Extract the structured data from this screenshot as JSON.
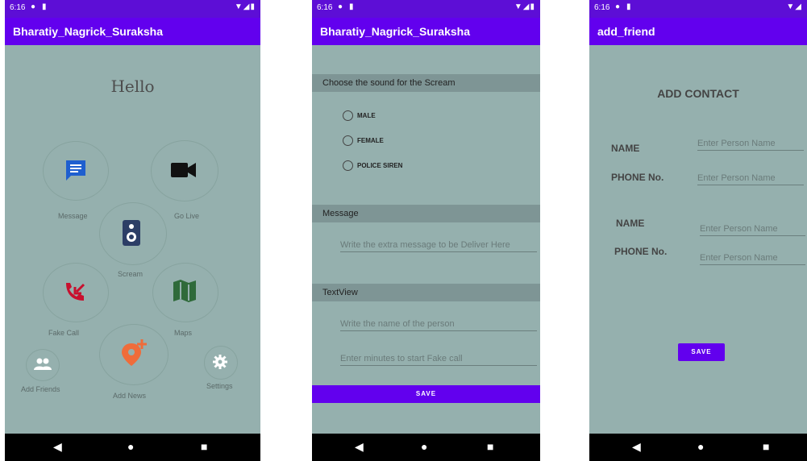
{
  "status_time": "6:16",
  "phone1": {
    "app_title": "Bharatiy_Nagrick_Suraksha",
    "greeting": "Hello",
    "buttons": {
      "message": "Message",
      "go_live": "Go Live",
      "scream": "Scream",
      "fake_call": "Fake Call",
      "maps": "Maps",
      "add_friends": "Add Friends",
      "add_news": "Add News",
      "settings": "Settings"
    }
  },
  "phone2": {
    "app_title": "Bharatiy_Nagrick_Suraksha",
    "sound_section": "Choose the sound for the Scream",
    "options": [
      "MALE",
      "FEMALE",
      "POLICE SIREN"
    ],
    "message_section": "Message",
    "message_placeholder": "Write the extra message to be Deliver Here",
    "textview_section": "TextView",
    "person_placeholder": "Write the name of the person",
    "minutes_placeholder": "Enter minutes to start Fake call",
    "save": "SAVE"
  },
  "phone3": {
    "app_title": "add_friend",
    "heading": "ADD CONTACT",
    "name_label": "NAME",
    "phone_label": "PHONE No.",
    "placeholder": "Enter Person Name",
    "save": "SAVE"
  },
  "colors": {
    "primary": "#6200ee",
    "background": "#95b0ae",
    "section_band": "#7e9595"
  }
}
